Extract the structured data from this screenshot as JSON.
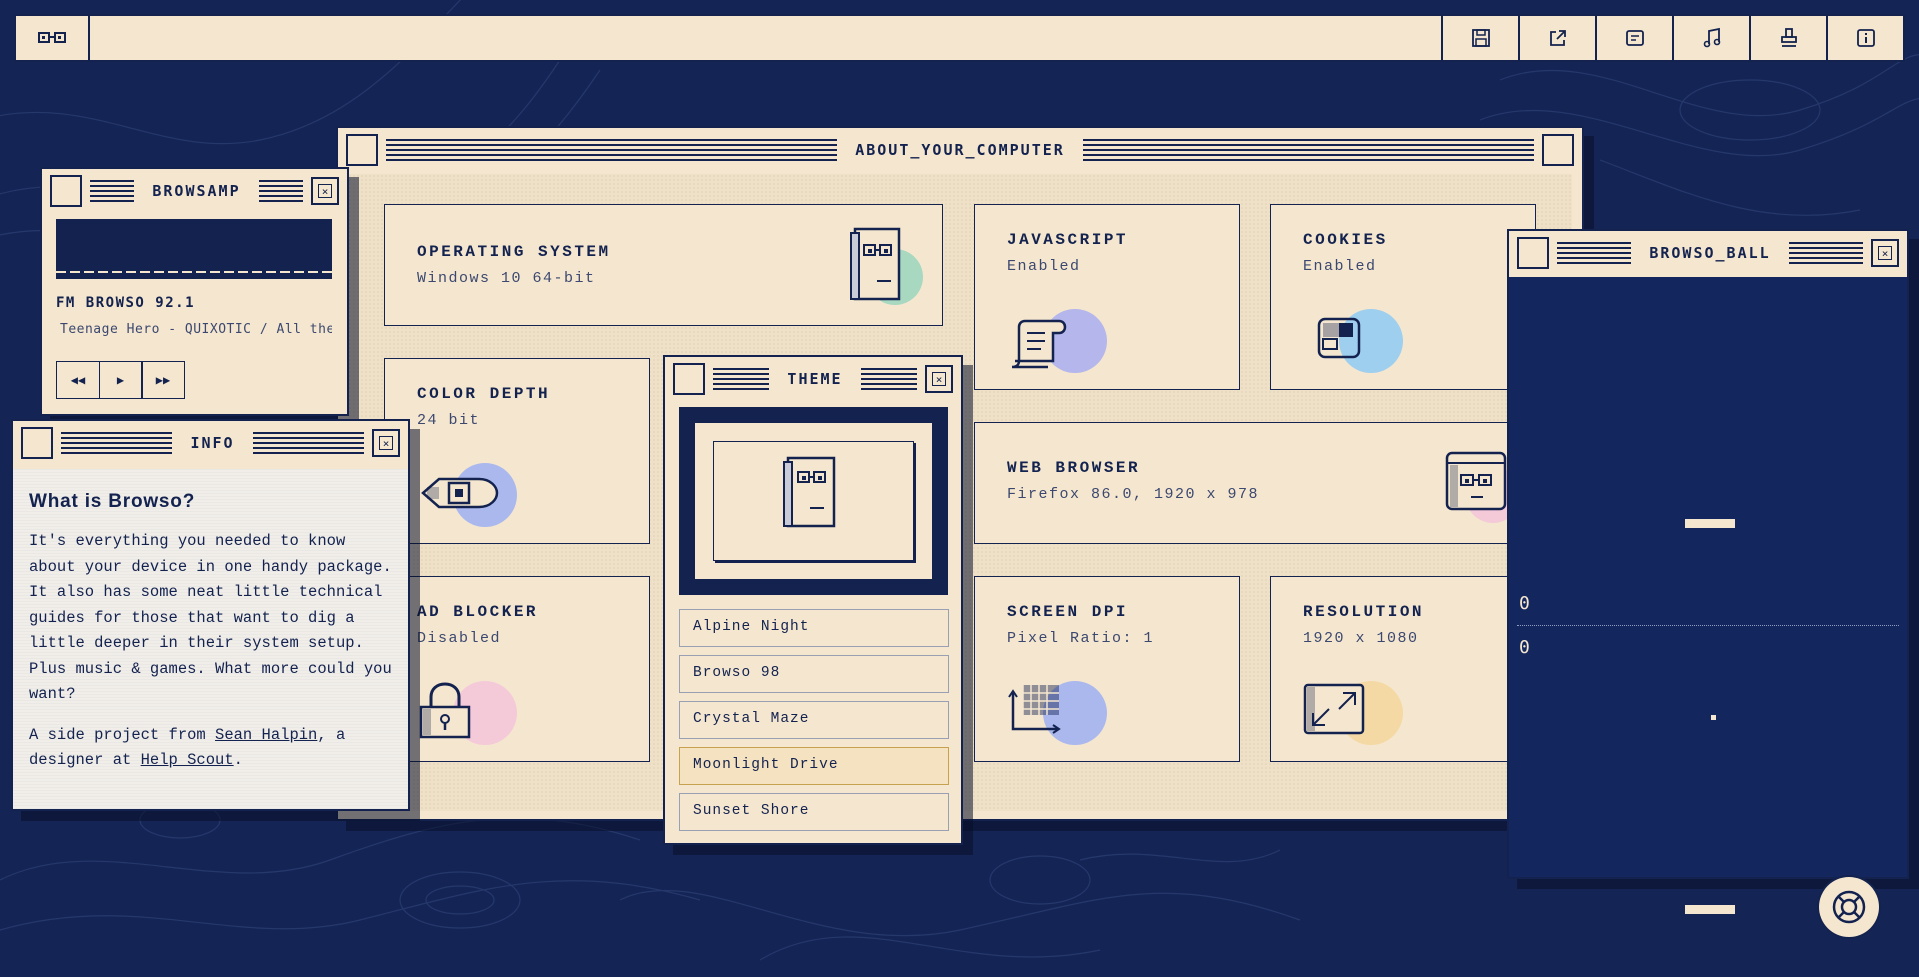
{
  "toolbar": {
    "logo_icon": "glasses-face-icon",
    "buttons": [
      {
        "name": "save-icon"
      },
      {
        "name": "share-icon"
      },
      {
        "name": "screenshot-icon"
      },
      {
        "name": "music-icon"
      },
      {
        "name": "stamp-icon"
      },
      {
        "name": "info-icon"
      }
    ]
  },
  "about_window": {
    "title": "ABOUT_YOUR_COMPUTER",
    "cards": {
      "os": {
        "title": "OPERATING SYSTEM",
        "value": "Windows 10 64-bit",
        "icon": "book-face-icon",
        "accent": "#a8d8c0"
      },
      "javascript": {
        "title": "JAVASCRIPT",
        "value": "Enabled",
        "icon": "scroll-icon",
        "accent": "#b4b6ec"
      },
      "cookies": {
        "title": "COOKIES",
        "value": "Enabled",
        "icon": "cookie-jar-icon",
        "accent": "#9fcfef"
      },
      "color_depth": {
        "title": "COLOR DEPTH",
        "value": "24 bit",
        "icon": "eye-icon",
        "accent": "#aab8ee"
      },
      "web_browser": {
        "title": "WEB BROWSER",
        "value": "Firefox 86.0, 1920 x 978",
        "icon": "browser-face-icon",
        "accent": "#f4c9d8"
      },
      "ad_blocker": {
        "title": "AD BLOCKER",
        "value": "Disabled",
        "icon": "padlock-icon",
        "accent": "#f4c9d8"
      },
      "screen_dpi": {
        "title": "SCREEN DPI",
        "value": "Pixel Ratio: 1",
        "icon": "pixel-grid-icon",
        "accent": "#aab8ee"
      },
      "resolution": {
        "title": "RESOLUTION",
        "value": "1920 x 1080",
        "icon": "resize-icon",
        "accent": "#f4d9a4"
      }
    }
  },
  "browsamp": {
    "title": "BROWSAMP",
    "station": "FM BROWSO 92.1",
    "now_playing": "Teenage Hero - QUIXOTIC  /  All the hit",
    "controls": [
      "rewind-icon",
      "play-icon",
      "fast-forward-icon"
    ]
  },
  "info_window": {
    "title": "INFO",
    "heading": "What is Browso?",
    "paragraph": "It's everything you needed to know about your device in one handy package. It also has some neat little technical guides for those that want to dig a little deeper in their system setup. Plus music & games. What more could you want?",
    "credit_prefix": "A side project from ",
    "author_link": "Sean Halpin",
    "credit_middle": ", a designer at ",
    "company_link": "Help Scout",
    "credit_suffix": "."
  },
  "theme_window": {
    "title": "THEME",
    "options": [
      "Alpine Night",
      "Browso 98",
      "Crystal Maze",
      "Moonlight Drive",
      "Sunset Shore"
    ],
    "selected": "Moonlight Drive"
  },
  "ball_window": {
    "title": "BROWSO_BALL",
    "score_top": "0",
    "score_bottom": "0"
  },
  "colors": {
    "background": "#142455",
    "panel": "#f5e7cf",
    "ink": "#13224f"
  },
  "help_button": {
    "icon": "lifebuoy-icon"
  }
}
